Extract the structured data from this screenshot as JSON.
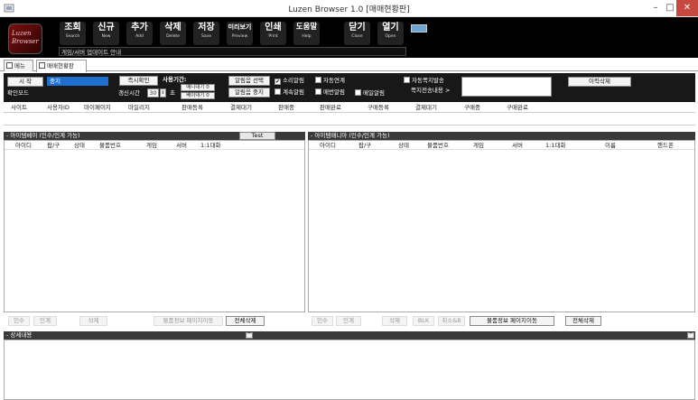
{
  "window": {
    "title": "Luzen Browser 1.0 [매매현황판]",
    "minimize": "–",
    "maximize": "□",
    "close": "✕"
  },
  "logo": {
    "line1": "Luzen",
    "line2": "Browser"
  },
  "toolbar": {
    "buttons": [
      {
        "kr": "조회",
        "en": "Search"
      },
      {
        "kr": "신규",
        "en": "New"
      },
      {
        "kr": "추가",
        "en": "Add"
      },
      {
        "kr": "삭제",
        "en": "Delete"
      },
      {
        "kr": "저장",
        "en": "Save"
      },
      {
        "kr": "미리보기",
        "en": "Preview"
      },
      {
        "kr": "인쇄",
        "en": "Print"
      },
      {
        "kr": "도움말",
        "en": "Help"
      },
      {
        "kr": "닫기",
        "en": "Close"
      },
      {
        "kr": "열기",
        "en": "Open"
      }
    ],
    "notice": "게임/서버 업데이트 안내"
  },
  "tabs": {
    "menu": "메뉴",
    "status": "매매현황판"
  },
  "filter": {
    "start": "시 작",
    "status_value": "중지",
    "confirm_mode": "확인모드",
    "instant_check": "즉시확인",
    "usage_label": "사용기간:",
    "refresh_label": "갱신시간",
    "refresh_value": "30",
    "refresh_unit": "초",
    "mania_wait": "매니대기 0",
    "bay_wait": "베이대기 0",
    "sound_select": "알림음 선택",
    "sound_stop": "알림음 중지",
    "sound_alert": "소리알림",
    "auto_link": "자동연계",
    "continuous": "계속알림",
    "direct_alert": "매번알림",
    "mail_alert": "메일알림",
    "auto_note": "자동쪽지발송",
    "note_msg": "쪽지전송내용 >",
    "history_delete": "이력삭제",
    "checks": {
      "sound_alert": true,
      "auto_link": false,
      "continuous": false,
      "direct_alert": false,
      "mail_alert": false,
      "auto_note": false
    }
  },
  "top_table": {
    "columns": [
      "사이트",
      "사용자ID",
      "마이페이지",
      "마일리지",
      "판매등록",
      "결제대기",
      "판매중",
      "판매완료",
      "구매등록",
      "결제대기",
      "구매중",
      "구매완료"
    ]
  },
  "left_pane": {
    "title": "- 아이템베이 (인수/인계 가능)",
    "test": "Test",
    "columns": [
      "아이디",
      "팝/구",
      "상태",
      "물품번호",
      "게임",
      "서버",
      "1:1대화"
    ],
    "buttons": {
      "take": "인수",
      "hand": "인계",
      "delete": "삭제",
      "goto": "물품정보 페이지이동",
      "delete_all": "전체삭제"
    }
  },
  "right_pane": {
    "title": "- 아이템매니아 (인수/인계 가능)",
    "columns": [
      "아이디",
      "팝/구",
      "상태",
      "물품번호",
      "게임",
      "서버",
      "1:1대화",
      "이름",
      "핸드폰"
    ],
    "buttons": {
      "take": "인수",
      "hand": "인계",
      "delete": "삭제",
      "blk": "BLK",
      "cancel": "취소&B",
      "goto": "물품정보 페이지이동",
      "delete_all": "전체삭제"
    }
  },
  "detail": {
    "title": "- 상세내용",
    "caret": "^"
  }
}
